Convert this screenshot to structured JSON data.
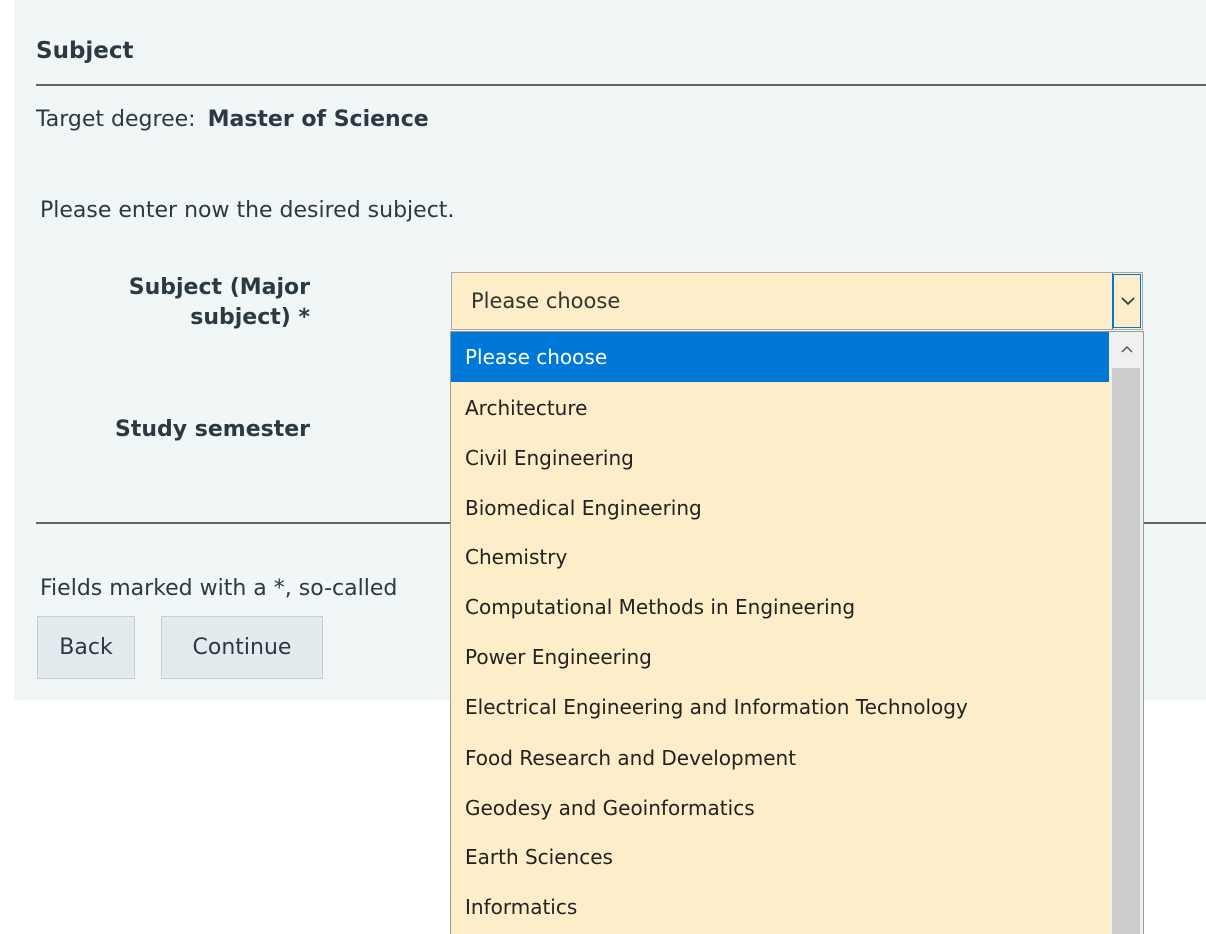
{
  "section": {
    "title": "Subject"
  },
  "degree": {
    "label": "Target degree:",
    "value": "Master of Science"
  },
  "intro": "Please enter now the desired subject.",
  "fields": {
    "subject_label": "Subject (Major subject) *",
    "subject_label_line1": "Subject (Major",
    "subject_label_line2": "subject) *",
    "subject_value": "Please choose",
    "semester_label": "Study semester"
  },
  "footer": {
    "note": "Fields marked with a *, so-called"
  },
  "buttons": {
    "back": "Back",
    "continue": "Continue"
  },
  "dropdown": {
    "options": [
      "Please choose",
      "Architecture",
      "Civil Engineering",
      "Biomedical Engineering",
      "Chemistry",
      "Computational Methods in Engineering",
      "Power Engineering",
      "Electrical Engineering and Information Technology",
      "Food Research and Development",
      "Geodesy and Geoinformatics",
      "Earth Sciences",
      "Informatics"
    ],
    "selected": "Please choose"
  },
  "icons": {
    "select_arrow": "chevron-down-icon",
    "scroll_up": "chevron-up-icon"
  },
  "colors": {
    "select_background": "#fdedc8",
    "highlight": "#0078d7",
    "panel_background": "#f1f6f6",
    "button_background": "#e4ebee"
  }
}
